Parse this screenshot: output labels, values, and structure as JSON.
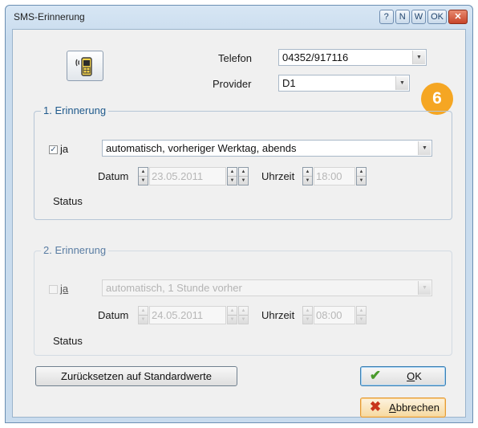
{
  "window": {
    "title": "SMS-Erinnerung",
    "buttons": [
      "?",
      "N",
      "W",
      "OK",
      "✕"
    ]
  },
  "header": {
    "telefon_label": "Telefon",
    "telefon_value": "04352/917116",
    "provider_label": "Provider",
    "provider_value": "D1",
    "badge": "6"
  },
  "reminder1": {
    "legend": "1. Erinnerung",
    "checked": true,
    "ja_label": "ja",
    "mode": "automatisch, vorheriger Werktag, abends",
    "datum_label": "Datum",
    "datum_value": "23.05.2011",
    "uhrzeit_label": "Uhrzeit",
    "uhrzeit_value": "18:00",
    "status_label": "Status"
  },
  "reminder2": {
    "legend": "2. Erinnerung",
    "checked": false,
    "ja_label": "ja",
    "mode": "automatisch, 1 Stunde vorher",
    "datum_label": "Datum",
    "datum_value": "24.05.2011",
    "uhrzeit_label": "Uhrzeit",
    "uhrzeit_value": "08:00",
    "status_label": "Status"
  },
  "actions": {
    "reset_label": "Zurücksetzen auf Standardwerte",
    "ok_label_underlined": "O",
    "ok_label_rest": "K",
    "cancel_label_underlined": "A",
    "cancel_label_rest": "bbrechen"
  },
  "icons": {
    "phone": "mobile-phone-icon",
    "ok": "checkmark-icon",
    "cancel": "x-icon"
  },
  "colors": {
    "badge": "#f5a623",
    "legend_text": "#1f5a8c",
    "ok_check": "#4a9a2c",
    "cancel_x": "#c8341c"
  }
}
